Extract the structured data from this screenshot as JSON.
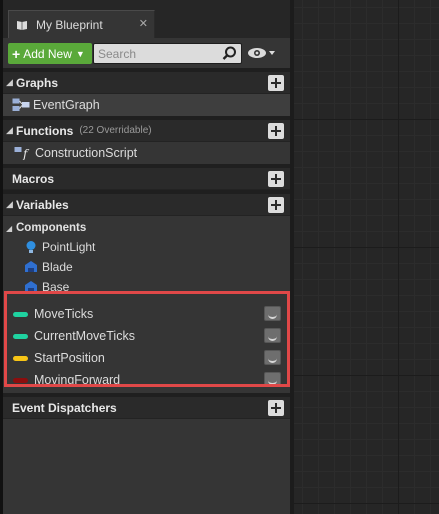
{
  "tab": {
    "title": "My Blueprint",
    "close": "✕"
  },
  "toolbar": {
    "add_new": "Add New",
    "search_placeholder": "Search"
  },
  "sections": {
    "graphs": {
      "title": "Graphs",
      "items": [
        "EventGraph"
      ]
    },
    "functions": {
      "title": "Functions",
      "subtitle": "(22 Overridable)",
      "items": [
        "ConstructionScript"
      ]
    },
    "macros": {
      "title": "Macros"
    },
    "variables": {
      "title": "Variables",
      "components": {
        "title": "Components",
        "items": [
          {
            "label": "PointLight",
            "icon": "pointlight-icon"
          },
          {
            "label": "Blade",
            "icon": "static-mesh-icon"
          },
          {
            "label": "Base",
            "icon": "static-mesh-icon"
          }
        ]
      },
      "items": [
        {
          "label": "MoveTicks",
          "color": "#1fd2a0"
        },
        {
          "label": "CurrentMoveTicks",
          "color": "#1fd2a0"
        },
        {
          "label": "StartPosition",
          "color": "#f7c516"
        },
        {
          "label": "MovingForward",
          "color": "#8c0e0e"
        }
      ]
    },
    "event_dispatchers": {
      "title": "Event Dispatchers"
    }
  },
  "colors": {
    "add_new": "#5aa93a",
    "highlight": "#e04848",
    "panel": "#353535"
  }
}
